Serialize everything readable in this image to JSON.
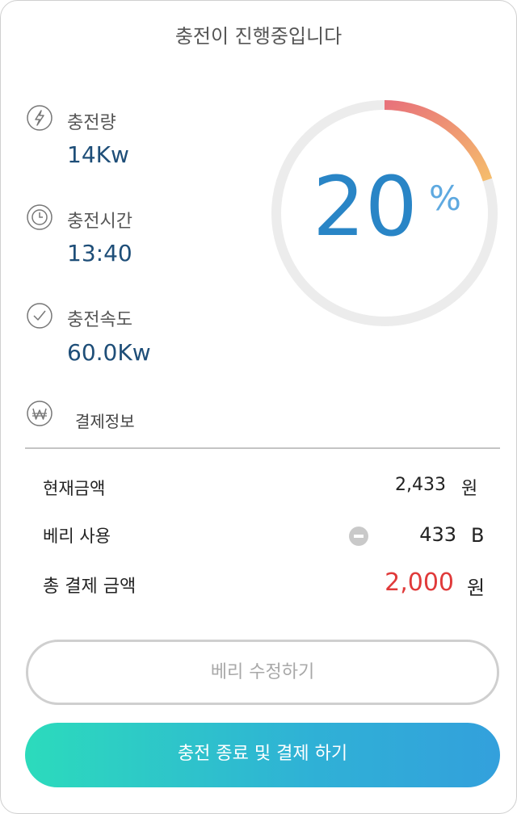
{
  "title": "충전이 진행중입니다",
  "stats": {
    "amount": {
      "label": "충전량",
      "value": "14Kw",
      "icon": "lightning-icon"
    },
    "time": {
      "label": "충전시간",
      "value": "13:40",
      "icon": "clock-icon"
    },
    "speed": {
      "label": "충전속도",
      "value": "60.0Kw",
      "icon": "checkmark-icon"
    }
  },
  "progress": {
    "number": "20",
    "unit": "%",
    "fraction": 0.2
  },
  "colors": {
    "gauge_start": "#e8727a",
    "gauge_end": "#f5bc6c",
    "gauge_track": "#ececec",
    "total_amount": "#e03a3a",
    "value_blue": "#1e4e78",
    "percent_blue": "#2985c6"
  },
  "payment": {
    "label": "결제정보",
    "icon": "won-icon",
    "current": {
      "label": "현재금액",
      "value": "2,433",
      "unit": "원"
    },
    "berry": {
      "label": "베리 사용",
      "value": "433",
      "unit": "B",
      "icon": "minus-circle-icon"
    },
    "total": {
      "label": "총 결제 금액",
      "value": "2,000",
      "unit": "원"
    }
  },
  "buttons": {
    "edit_berry": "베리 수정하기",
    "finish": "충전 종료 및 결제 하기"
  }
}
